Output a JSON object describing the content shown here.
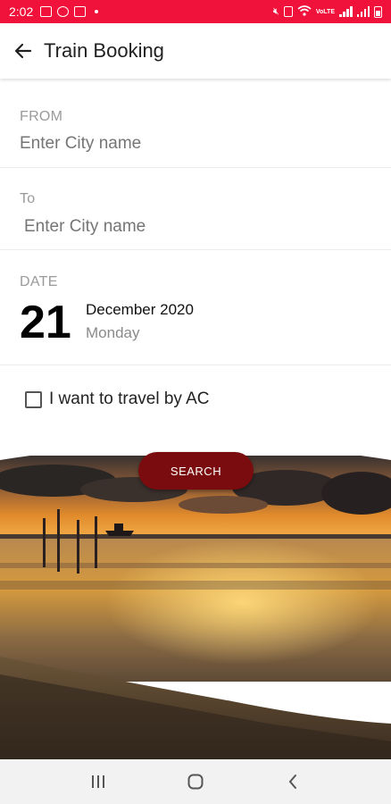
{
  "status_bar": {
    "time": "2:02",
    "left_icons": [
      "gallery-icon",
      "whatsapp-icon",
      "instagram-icon"
    ],
    "right_icons": [
      "mute-icon",
      "alarm-icon",
      "wifi-icon",
      "signal-icon",
      "signal-icon",
      "battery-icon"
    ],
    "lte_label": "VoLTE",
    "color": "#f0123a"
  },
  "app_bar": {
    "back_icon": "arrow-left-icon",
    "title": "Train Booking"
  },
  "form": {
    "from": {
      "label": "FROM",
      "placeholder": "Enter City name"
    },
    "to": {
      "label": "To",
      "placeholder": "Enter City name"
    },
    "date": {
      "label": "DATE",
      "day": "21",
      "month_year": "December 2020",
      "weekday": "Monday"
    },
    "ac_option": {
      "label": "I want to travel by AC",
      "checked": false
    }
  },
  "search_button": {
    "label": "SEARCH",
    "color": "#7a0b0e"
  },
  "nav_bar": {
    "icons": [
      "recent-apps-icon",
      "home-icon",
      "back-icon"
    ]
  }
}
